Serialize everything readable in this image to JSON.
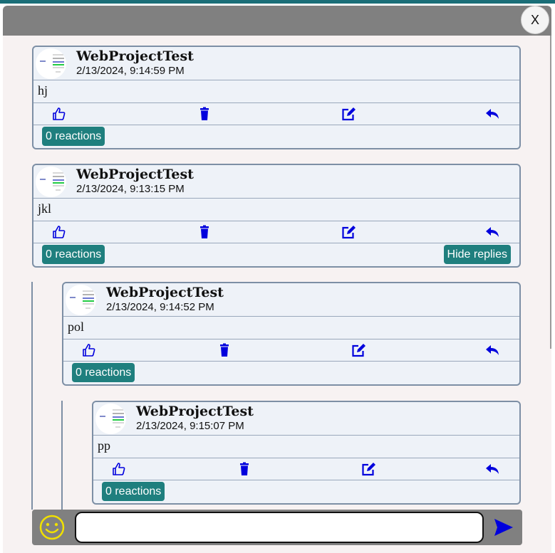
{
  "modal": {
    "close_label": "X"
  },
  "comments": [
    {
      "author": "WebProjectTest",
      "timestamp": "2/13/2024, 9:14:59 PM",
      "text": "hj",
      "reactions": "0 reactions"
    },
    {
      "author": "WebProjectTest",
      "timestamp": "2/13/2024, 9:13:15 PM",
      "text": "jkl",
      "reactions": "0 reactions",
      "replies_toggle": "Hide replies"
    },
    {
      "author": "WebProjectTest",
      "timestamp": "2/13/2024, 9:14:52 PM",
      "text": "pol",
      "reactions": "0 reactions"
    },
    {
      "author": "WebProjectTest",
      "timestamp": "2/13/2024, 9:15:07 PM",
      "text": "pp",
      "reactions": "0 reactions"
    }
  ],
  "composer": {
    "input_value": "",
    "emoji_icon": "smiley-icon",
    "send_icon": "send-arrow-icon"
  },
  "icons": {
    "like": "thumbs-up-icon",
    "delete": "trash-icon",
    "edit": "edit-icon",
    "reply": "reply-icon"
  },
  "colors": {
    "header": "#808080",
    "accent": "#1f7f7e",
    "icon_blue": "#0000dd",
    "emoji_yellow": "#f0e000",
    "card_border": "#7d8fa5"
  }
}
